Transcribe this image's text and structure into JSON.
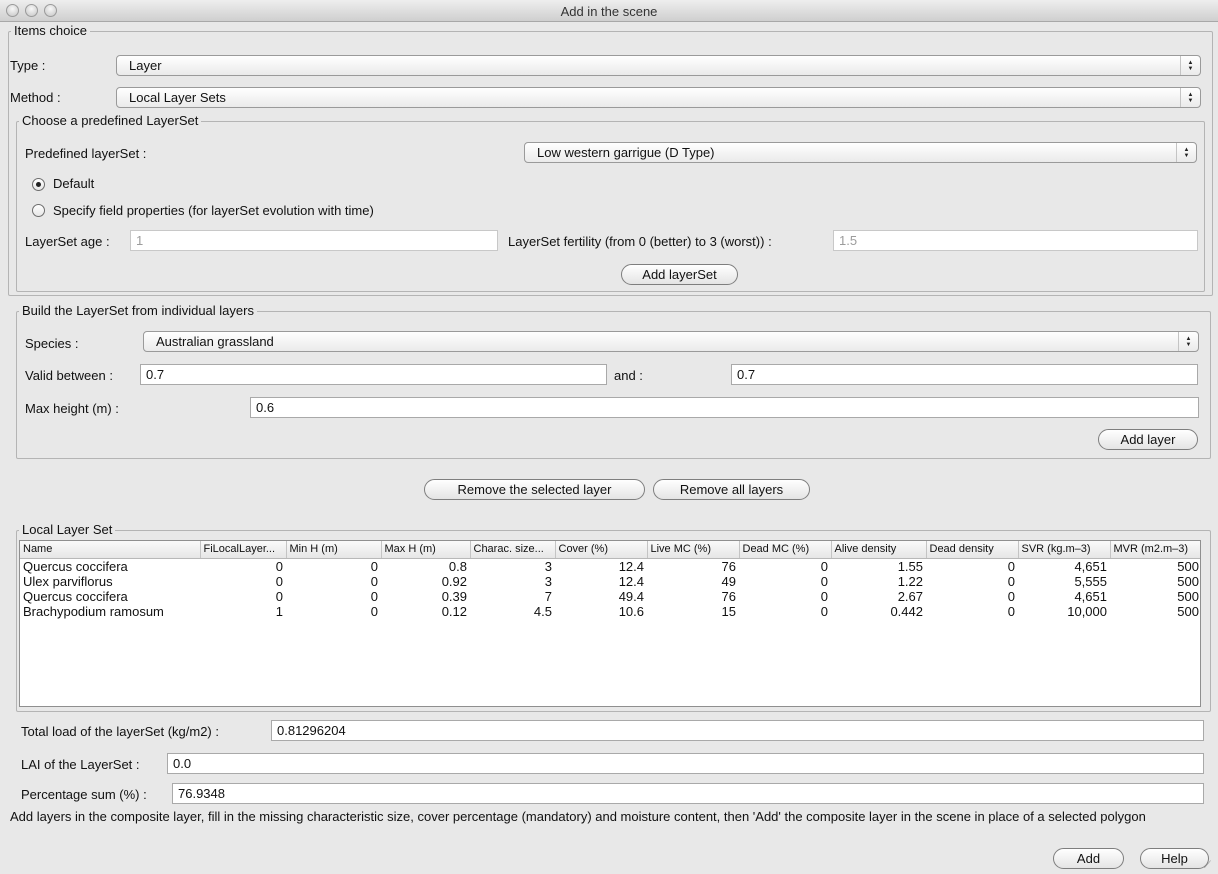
{
  "window": {
    "title": "Add in the scene"
  },
  "items_choice": {
    "legend": "Items choice",
    "type_label": "Type :",
    "type_value": "Layer",
    "method_label": "Method :",
    "method_value": "Local Layer Sets"
  },
  "predefined": {
    "legend": "Choose a predefined LayerSet",
    "label": "Predefined layerSet :",
    "value": "Low western garrigue (D Type)",
    "radio_default": "Default",
    "radio_specify": "Specify field properties (for layerSet evolution with time)",
    "age_label": "LayerSet age :",
    "age_value": "1",
    "fertility_label": "LayerSet fertility (from 0 (better) to 3 (worst)) :",
    "fertility_value": "1.5",
    "add_button": "Add layerSet"
  },
  "build": {
    "legend": "Build the LayerSet from individual layers",
    "species_label": "Species :",
    "species_value": "Australian grassland",
    "valid_label": "Valid between :",
    "valid_from": "0.7",
    "and_label": "and :",
    "valid_to": "0.7",
    "max_height_label": "Max height (m) :",
    "max_height_value": "0.6",
    "add_button": "Add layer"
  },
  "actions": {
    "remove_selected": "Remove the selected layer",
    "remove_all": "Remove all layers"
  },
  "local_set": {
    "legend": "Local Layer Set",
    "columns": [
      "Name",
      "FiLocalLayer...",
      "Min H (m)",
      "Max H (m)",
      "Charac. size...",
      "Cover (%)",
      "Live MC (%)",
      "Dead MC (%)",
      "Alive density",
      "Dead density",
      "SVR (kg.m–3)",
      "MVR (m2.m–3)"
    ],
    "rows": [
      [
        "Quercus coccifera",
        "0",
        "0",
        "0.8",
        "3",
        "12.4",
        "76",
        "0",
        "1.55",
        "0",
        "4,651",
        "500"
      ],
      [
        "Ulex parviflorus",
        "0",
        "0",
        "0.92",
        "3",
        "12.4",
        "49",
        "0",
        "1.22",
        "0",
        "5,555",
        "500"
      ],
      [
        "Quercus coccifera",
        "0",
        "0",
        "0.39",
        "7",
        "49.4",
        "76",
        "0",
        "2.67",
        "0",
        "4,651",
        "500"
      ],
      [
        "Brachypodium ramosum",
        "1",
        "0",
        "0.12",
        "4.5",
        "10.6",
        "15",
        "0",
        "0.442",
        "0",
        "10,000",
        "500"
      ]
    ]
  },
  "totals": {
    "load_label": "Total load of the layerSet (kg/m2) :",
    "load_value": "0.81296204",
    "lai_label": "LAI of the LayerSet :",
    "lai_value": "0.0",
    "pct_label": "Percentage sum (%) :",
    "pct_value": "76.9348"
  },
  "hint": "Add layers in the composite layer, fill in the missing characteristic size, cover percentage (mandatory) and moisture content, then 'Add' the composite layer in the scene in place of a selected polygon",
  "footer": {
    "add": "Add",
    "help": "Help"
  }
}
